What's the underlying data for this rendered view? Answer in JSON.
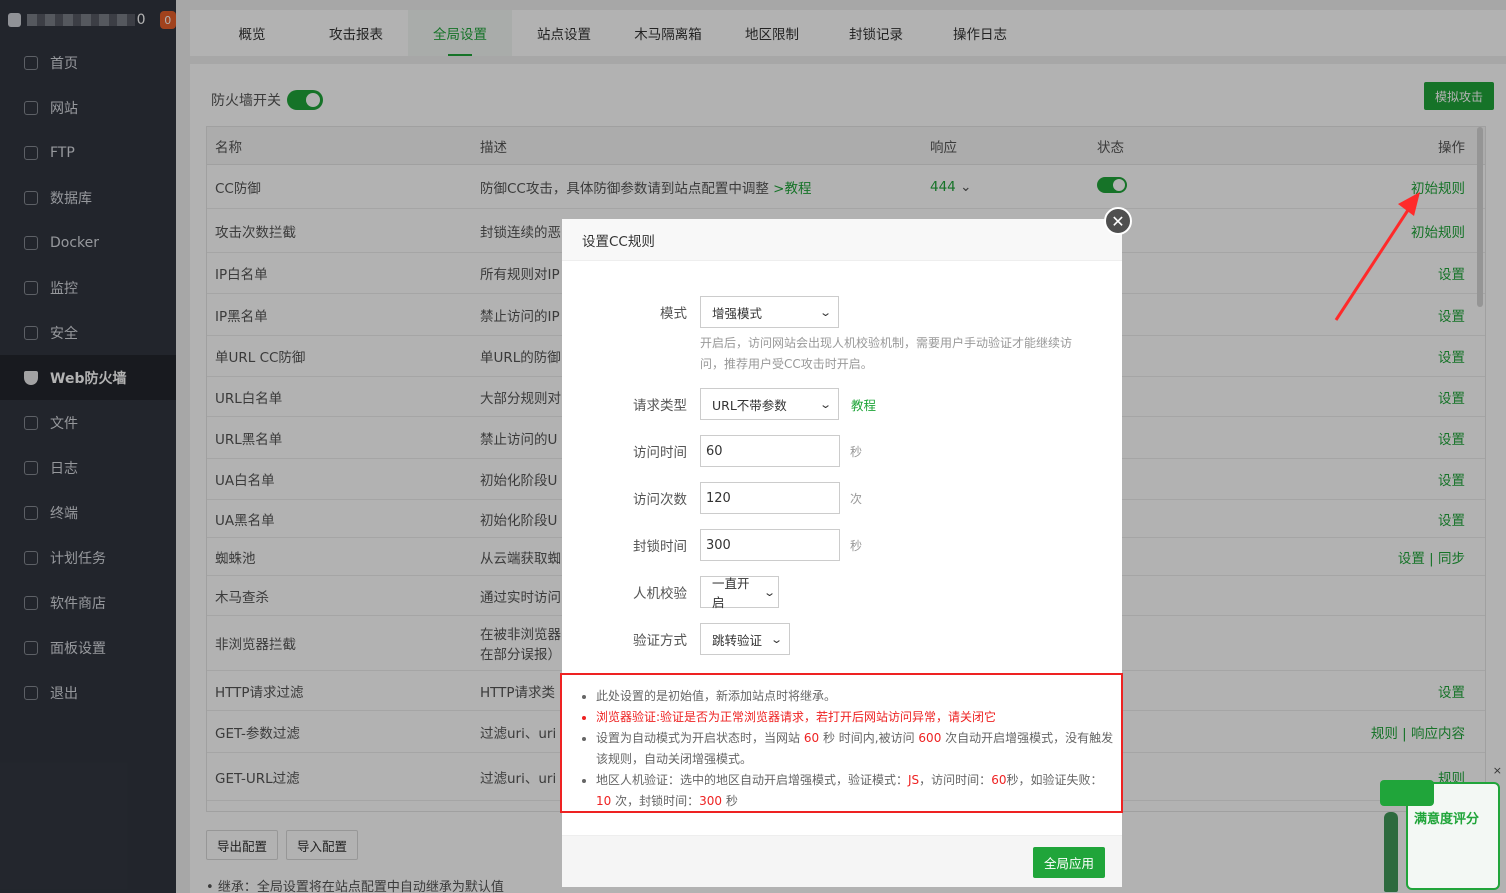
{
  "sidebar": {
    "user_suffix": "0",
    "badge": "0",
    "items": [
      {
        "label": "首页",
        "icon": "home-icon"
      },
      {
        "label": "网站",
        "icon": "globe-icon"
      },
      {
        "label": "FTP",
        "icon": "ftp-icon"
      },
      {
        "label": "数据库",
        "icon": "database-icon"
      },
      {
        "label": "Docker",
        "icon": "docker-icon"
      },
      {
        "label": "监控",
        "icon": "monitor-icon"
      },
      {
        "label": "安全",
        "icon": "shield-icon"
      },
      {
        "label": "Web防火墙",
        "icon": "firewall-icon"
      },
      {
        "label": "文件",
        "icon": "folder-icon"
      },
      {
        "label": "日志",
        "icon": "log-icon"
      },
      {
        "label": "终端",
        "icon": "terminal-icon"
      },
      {
        "label": "计划任务",
        "icon": "calendar-icon"
      },
      {
        "label": "软件商店",
        "icon": "apps-icon"
      },
      {
        "label": "面板设置",
        "icon": "gear-icon"
      },
      {
        "label": "退出",
        "icon": "logout-icon"
      }
    ]
  },
  "tabs": [
    "概览",
    "攻击报表",
    "全局设置",
    "站点设置",
    "木马隔离箱",
    "地区限制",
    "封锁记录",
    "操作日志"
  ],
  "firewall": {
    "label": "防火墙开关",
    "simulate_button": "模拟攻击"
  },
  "table": {
    "headers": {
      "name": "名称",
      "desc": "描述",
      "resp": "响应",
      "state": "状态",
      "op": "操作"
    },
    "rows": [
      {
        "name": "CC防御",
        "desc": "防御CC攻击，具体防御参数请到站点配置中调整",
        "desc_link": ">教程",
        "resp": "444",
        "op": "初始规则"
      },
      {
        "name": "攻击次数拦截",
        "desc": "封锁连续的恶",
        "op": "初始规则"
      },
      {
        "name": "IP白名单",
        "desc": "所有规则对IP",
        "op": "设置"
      },
      {
        "name": "IP黑名单",
        "desc": "禁止访问的IP",
        "op": "设置"
      },
      {
        "name": "单URL CC防御",
        "desc": "单URL的防御",
        "op": "设置"
      },
      {
        "name": "URL白名单",
        "desc": "大部分规则对",
        "op": "设置"
      },
      {
        "name": "URL黑名单",
        "desc": "禁止访问的U",
        "op": "设置"
      },
      {
        "name": "UA白名单",
        "desc": "初始化阶段U",
        "op": "设置"
      },
      {
        "name": "UA黑名单",
        "desc": "初始化阶段U",
        "op": "设置"
      },
      {
        "name": "蜘蛛池",
        "desc": "从云端获取蜘",
        "op": "设置 | 同步"
      },
      {
        "name": "木马查杀",
        "desc": "通过实时访问",
        "op": ""
      },
      {
        "name": "非浏览器拦截",
        "desc": "在被非浏览器",
        "desc2": "在部分误报）",
        "op": ""
      },
      {
        "name": "HTTP请求过滤",
        "desc": "HTTP请求类",
        "op": "设置"
      },
      {
        "name": "GET-参数过滤",
        "desc": "过滤uri、uri",
        "op": "规则 | 响应内容"
      },
      {
        "name": "GET-URL过滤",
        "desc": "过滤uri、uri",
        "op": "规则"
      }
    ]
  },
  "bottom": {
    "export_button": "导出配置",
    "import_button": "导入配置",
    "note": "继承：全局设置将在站点配置中自动继承为默认值"
  },
  "dialog": {
    "title": "设置CC规则",
    "close": "✕",
    "fields": {
      "mode": {
        "label": "模式",
        "value": "增强模式"
      },
      "mode_hint": "开启后，访问网站会出现人机校验机制，需要用户手动验证才能继续访问，推荐用户受CC攻击时开启。",
      "request_type": {
        "label": "请求类型",
        "value": "URL不带参数",
        "link": "教程"
      },
      "visit_time": {
        "label": "访问时间",
        "value": "60",
        "unit": "秒"
      },
      "visit_count": {
        "label": "访问次数",
        "value": "120",
        "unit": "次"
      },
      "block_time": {
        "label": "封锁时间",
        "value": "300",
        "unit": "秒"
      },
      "captcha": {
        "label": "人机校验",
        "value": "一直开启"
      },
      "verify_method": {
        "label": "验证方式",
        "value": "跳转验证"
      }
    },
    "notes": {
      "n1": "此处设置的是初始值，新添加站点时将继承。",
      "n2": "浏览器验证:验证是否为正常浏览器请求，若打开后网站访问异常，请关闭它",
      "n3_a": "设置为自动模式为开启状态时，当网站",
      "n3_v1": "60",
      "n3_b": "秒 时间内,被访问",
      "n3_v2": "600",
      "n3_c": "次自动开启增强模式，没有触发该规则，自动关闭增强模式。",
      "n4_a": "地区人机验证：选中的地区自动开启增强模式，验证模式：",
      "n4_v1": "JS",
      "n4_b": "，访问时间：",
      "n4_v2": "60",
      "n4_c": "秒，如验证失败：",
      "n4_v3": "10",
      "n4_d": "次，封锁时间：",
      "n4_v4": "300",
      "n4_e": "秒"
    },
    "apply_button": "全局应用"
  },
  "widget": {
    "label": "满意度评分",
    "close": "×"
  },
  "colors": {
    "accent": "#20a53a",
    "sidebar": "#323640",
    "highlight": "#e22222"
  }
}
